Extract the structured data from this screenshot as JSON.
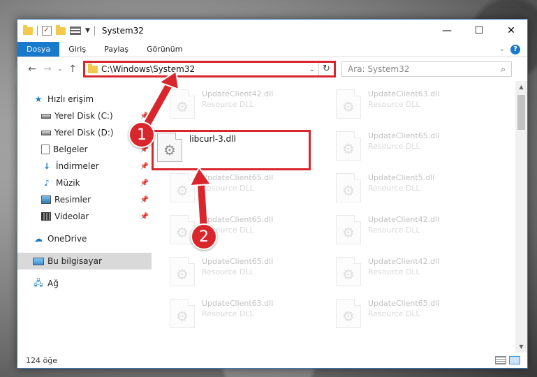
{
  "window": {
    "title": "System32"
  },
  "ribbon": {
    "tabs": [
      "Dosya",
      "Giriş",
      "Paylaş",
      "Görünüm"
    ],
    "active": 0
  },
  "address": {
    "path": "C:\\Windows\\System32",
    "search_placeholder": "Ara: System32"
  },
  "sidebar": {
    "quick_access": "Hızlı erişim",
    "items": [
      {
        "label": "Yerel Disk (C:)",
        "icon": "drive-icon"
      },
      {
        "label": "Yerel Disk (D:)",
        "icon": "drive-icon"
      },
      {
        "label": "Belgeler",
        "icon": "documents-icon"
      },
      {
        "label": "İndirmeler",
        "icon": "download-icon"
      },
      {
        "label": "Müzik",
        "icon": "music-icon"
      },
      {
        "label": "Resimler",
        "icon": "pictures-icon"
      },
      {
        "label": "Videolar",
        "icon": "videos-icon"
      }
    ],
    "onedrive": "OneDrive",
    "this_pc": "Bu bilgisayar",
    "network": "Ağ"
  },
  "files": {
    "highlighted": {
      "name": "libcurl-3.dll"
    },
    "background": [
      {
        "name": "UpdateClient42.dll",
        "type": "Resource DLL"
      },
      {
        "name": "UpdateClient63.dll",
        "type": "Resource DLL"
      },
      {
        "name": "",
        "type": ""
      },
      {
        "name": "UpdateClient65.dll",
        "type": "Resource DLL"
      },
      {
        "name": "UpdateClient65.dll",
        "type": "Resource DLL"
      },
      {
        "name": "UpdateClient5.dll",
        "type": "Resource DLL"
      },
      {
        "name": "UpdateClient65.dll",
        "type": "Resource DLL"
      },
      {
        "name": "UpdateClient42.dll",
        "type": "Resource DLL"
      },
      {
        "name": "UpdateClient65.dll",
        "type": "Resource DLL"
      },
      {
        "name": "UpdateClient42.dll",
        "type": "Resource DLL"
      },
      {
        "name": "UpdateClient63.dll",
        "type": "Resource DLL"
      },
      {
        "name": "UpdateClient65.dll",
        "type": "Resource DLL"
      }
    ]
  },
  "status": {
    "count": "124 öğe"
  },
  "annotations": {
    "step1": "1",
    "step2": "2",
    "color": "#d8262c"
  }
}
